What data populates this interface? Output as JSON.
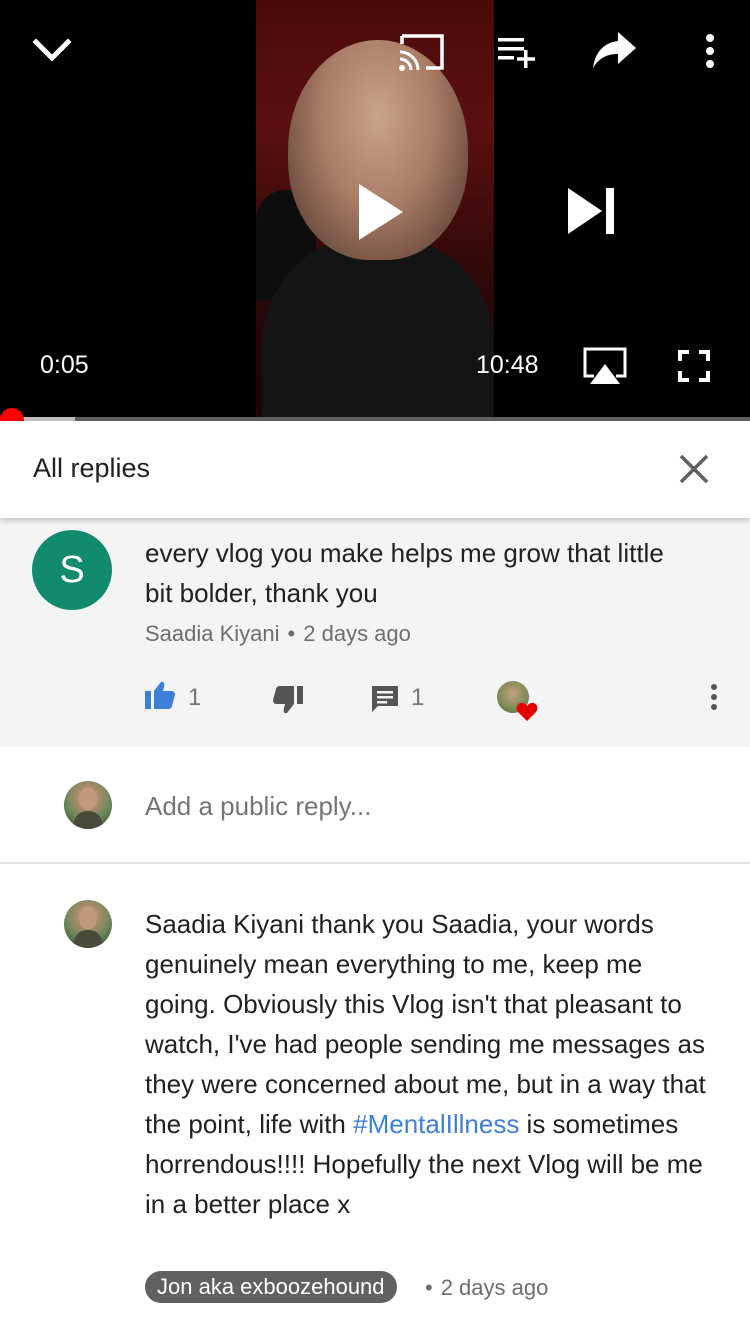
{
  "player": {
    "current_time": "0:05",
    "duration": "10:48",
    "progress_fraction": 0.008,
    "buffered_fraction": 0.1
  },
  "replies_panel": {
    "title": "All replies"
  },
  "parent_comment": {
    "avatar_letter": "S",
    "text_line1": "every vlog you make helps me grow that little",
    "text_line2": "bit bolder, thank you",
    "author": "Saadia Kiyani",
    "separator": "•",
    "time": "2 days ago",
    "like_count": "1",
    "reply_count": "1"
  },
  "add_reply": {
    "placeholder": "Add a public reply..."
  },
  "reply_comment": {
    "text_before_hashtag": "Saadia Kiyani thank you Saadia, your words genuinely mean everything to me, keep me going. Obviously this Vlog isn't that pleasant to watch, I've had people sending me messages as they were concerned about me, but in a way that the point, life with ",
    "hashtag": "#MentalIllness",
    "text_after_hashtag": " is sometimes horrendous!!!! Hopefully the next Vlog will be me in a better place x",
    "author": "Jon aka exboozehound",
    "separator": "•",
    "time": "2 days ago"
  },
  "colors": {
    "accent_red": "#ff0000",
    "like_blue": "#3e7fd8",
    "avatar_green": "#128a6e",
    "hashtag_blue": "#3e7fd8"
  },
  "icons": {
    "collapse": "chevron-down-icon",
    "cast": "cast-icon",
    "add_to_queue": "playlist-add-icon",
    "share": "share-icon",
    "more": "more-vertical-icon",
    "play": "play-icon",
    "next": "skip-next-icon",
    "airplay": "airplay-icon",
    "fullscreen": "fullscreen-icon",
    "close": "close-icon",
    "like": "thumbs-up-icon",
    "dislike": "thumbs-down-icon",
    "reply": "comment-icon",
    "creator_heart": "heart-icon"
  }
}
